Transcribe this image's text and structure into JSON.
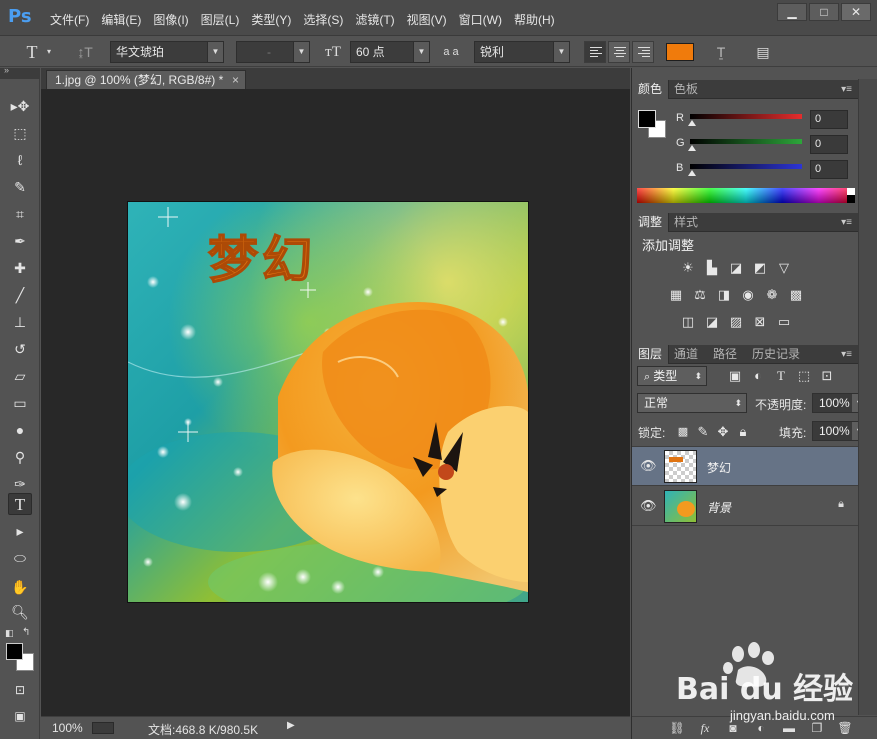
{
  "app": {
    "logo": "Ps",
    "menu": [
      "文件(F)",
      "编辑(E)",
      "图像(I)",
      "图层(L)",
      "类型(Y)",
      "选择(S)",
      "滤镜(T)",
      "视图(V)",
      "窗口(W)",
      "帮助(H)"
    ],
    "window_controls": [
      "▁",
      "□",
      "✕"
    ]
  },
  "options": {
    "tool_icon": "text-tool-icon",
    "font_family": "华文琥珀",
    "font_style": "-",
    "font_size": "60 点",
    "antialias_label": "a a",
    "antialias": "锐利",
    "text_color": "#f07b0c"
  },
  "document": {
    "tab_title": "1.jpg @ 100% (梦幻, RGB/8#) *",
    "tab_close": "×",
    "text_layer_content": "梦幻",
    "zoom": "100%",
    "doc_info": "文档:468.8 K/980.5K"
  },
  "color_panel": {
    "tabs": [
      "颜色",
      "色板"
    ],
    "channels": [
      {
        "label": "R",
        "value": "0",
        "color": "#e52d2d"
      },
      {
        "label": "G",
        "value": "0",
        "color": "#2da63a"
      },
      {
        "label": "B",
        "value": "0",
        "color": "#2d35d6"
      }
    ]
  },
  "adjust_panel": {
    "tabs": [
      "调整",
      "样式"
    ],
    "title": "添加调整"
  },
  "layers_panel": {
    "tabs": [
      "图层",
      "通道",
      "路径",
      "历史记录"
    ],
    "filter_kind": "类型",
    "blend_mode": "正常",
    "opacity_label": "不透明度:",
    "opacity": "100%",
    "lock_label": "锁定:",
    "fill_label": "填充:",
    "fill": "100%",
    "layers": [
      {
        "name": "梦幻",
        "selected": true,
        "locked": false
      },
      {
        "name": "背景",
        "selected": false,
        "locked": true
      }
    ],
    "footer_icons": [
      "link-icon",
      "fx-icon",
      "mask-icon",
      "adjustment-icon",
      "folder-icon",
      "new-layer-icon",
      "trash-icon"
    ]
  },
  "watermark": {
    "brand": "Bai du 经验",
    "url": "jingyan.baidu.com"
  }
}
